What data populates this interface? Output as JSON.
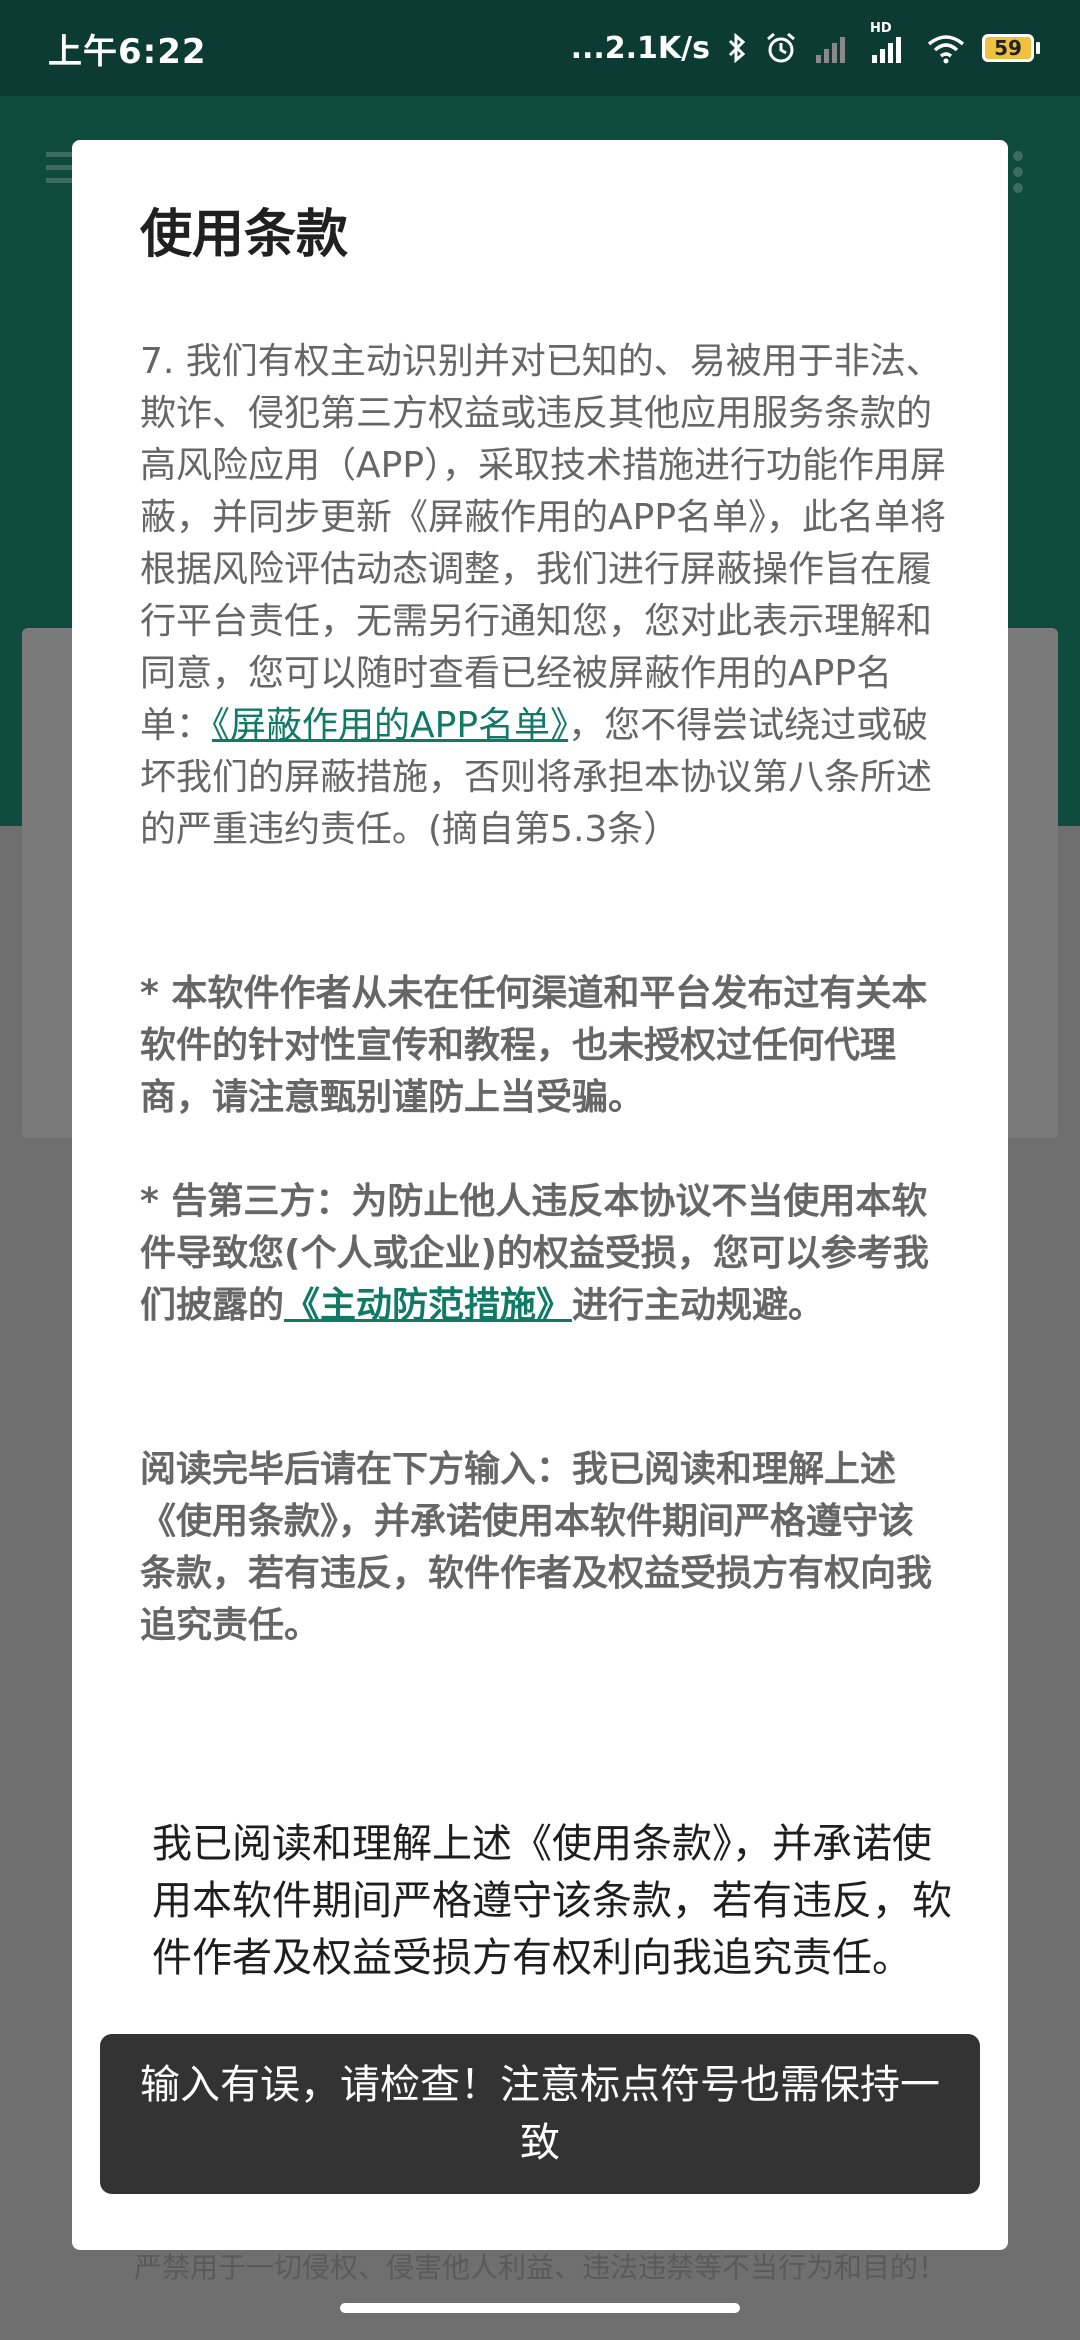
{
  "status_bar": {
    "time": "上午6:22",
    "network_speed": "...2.1K/s",
    "hd_label": "HD",
    "battery_level": "59"
  },
  "dialog": {
    "title": "使用条款",
    "para7": {
      "text_before_link": "7. 我们有权主动识别并对已知的、易被用于非法、欺诈、侵犯第三方权益或违反其他应用服务条款的高风险应用（APP），采取技术措施进行功能作用屏蔽，并同步更新《屏蔽作用的APP名单》，此名单将根据风险评估动态调整，我们进行屏蔽操作旨在履行平台责任，无需另行通知您，您对此表示理解和同意，您可以随时查看已经被屏蔽作用的APP名单：",
      "link": "《屏蔽作用的APP名单》",
      "text_after_link": "，您不得尝试绕过或破坏我们的屏蔽措施，否则将承担本协议第八条所述的严重违约责任。(摘自第5.3条）"
    },
    "notice_author": "* 本软件作者从未在任何渠道和平台发布过有关本软件的针对性宣传和教程，也未授权过任何代理商，请注意甄别谨防上当受骗。",
    "notice_third_party": {
      "text_before_link": "* 告第三方：为防止他人违反本协议不当使用本软件导致您(个人或企业)的权益受损，您可以参考我们披露的",
      "link": "《主动防范措施》",
      "text_after_link": "进行主动规避。"
    },
    "instruction": "阅读完毕后请在下方输入：我已阅读和理解上述《使用条款》，并承诺使用本软件期间严格遵守该条款，若有违反，软件作者及权益受损方有权向我追究责任。",
    "input_value": "我已阅读和理解上述《使用条款》，并承诺使用本软件期间严格遵守该条款，若有违反，软件作者及权益受损方有权利向我追究责任。"
  },
  "toast": {
    "message": "输入有误，请检查！注意标点符号也需保持一致"
  },
  "background": {
    "bottom_text": "严禁用于一切侵权、侵害他人利益、违法违禁等不当行为和目的！"
  },
  "colors": {
    "accent": "#117a67",
    "status_bar": "#0b3b32",
    "toast_bg": "#333333"
  }
}
